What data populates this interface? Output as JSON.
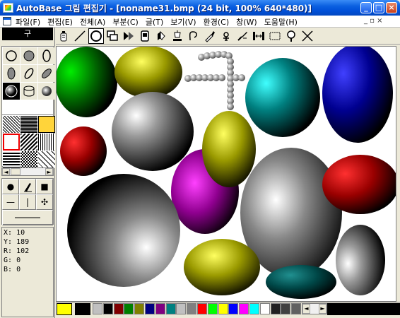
{
  "window": {
    "title": "AutoBase 그림 편집기 - [noname31.bmp (24 bit, 100% 640*480)]",
    "minimize_glyph": "_",
    "maximize_glyph": "□",
    "close_glyph": "×"
  },
  "menu": {
    "items": [
      "파일(F)",
      "편집(E)",
      "전체(A)",
      "부분(C)",
      "글(T)",
      "보기(V)",
      "환경(C)",
      "창(W)",
      "도움말(H)"
    ],
    "restore_glyph": "_ ▫ ×"
  },
  "left_panel": {
    "char_display": "구",
    "status": {
      "x_label": "X:",
      "x_value": "10",
      "y_label": "Y:",
      "y_value": "189",
      "r_label": "R:",
      "r_value": "102",
      "g_label": "G:",
      "g_value": "0",
      "b_label": "B:",
      "b_value": "0"
    }
  },
  "toolbar": {
    "tools": [
      "spray-can-icon",
      "line-icon",
      "ellipse-icon",
      "rect-copy-icon",
      "fill-arrow-icon",
      "stamp-icon",
      "eraser-icon",
      "bucket-icon",
      "lasso-icon",
      "eyedropper-icon",
      "gear-icon",
      "brush-icon",
      "stretch-icon",
      "rect-select-icon",
      "magnify-icon",
      "cross-icon"
    ]
  },
  "palette": {
    "foreground": "#ffff00",
    "background": "#000000",
    "colors": [
      "#c0c0c0",
      "#000000",
      "#800000",
      "#008000",
      "#808000",
      "#000080",
      "#800080",
      "#008080",
      "#c0c0c0",
      "#808080",
      "#ff0000",
      "#00ff00",
      "#ffff00",
      "#0000ff",
      "#ff00ff",
      "#00ffff",
      "#ffffff",
      "#202020",
      "#404040",
      "#606060"
    ],
    "scroll_left": "◄",
    "scroll_right": "►"
  }
}
